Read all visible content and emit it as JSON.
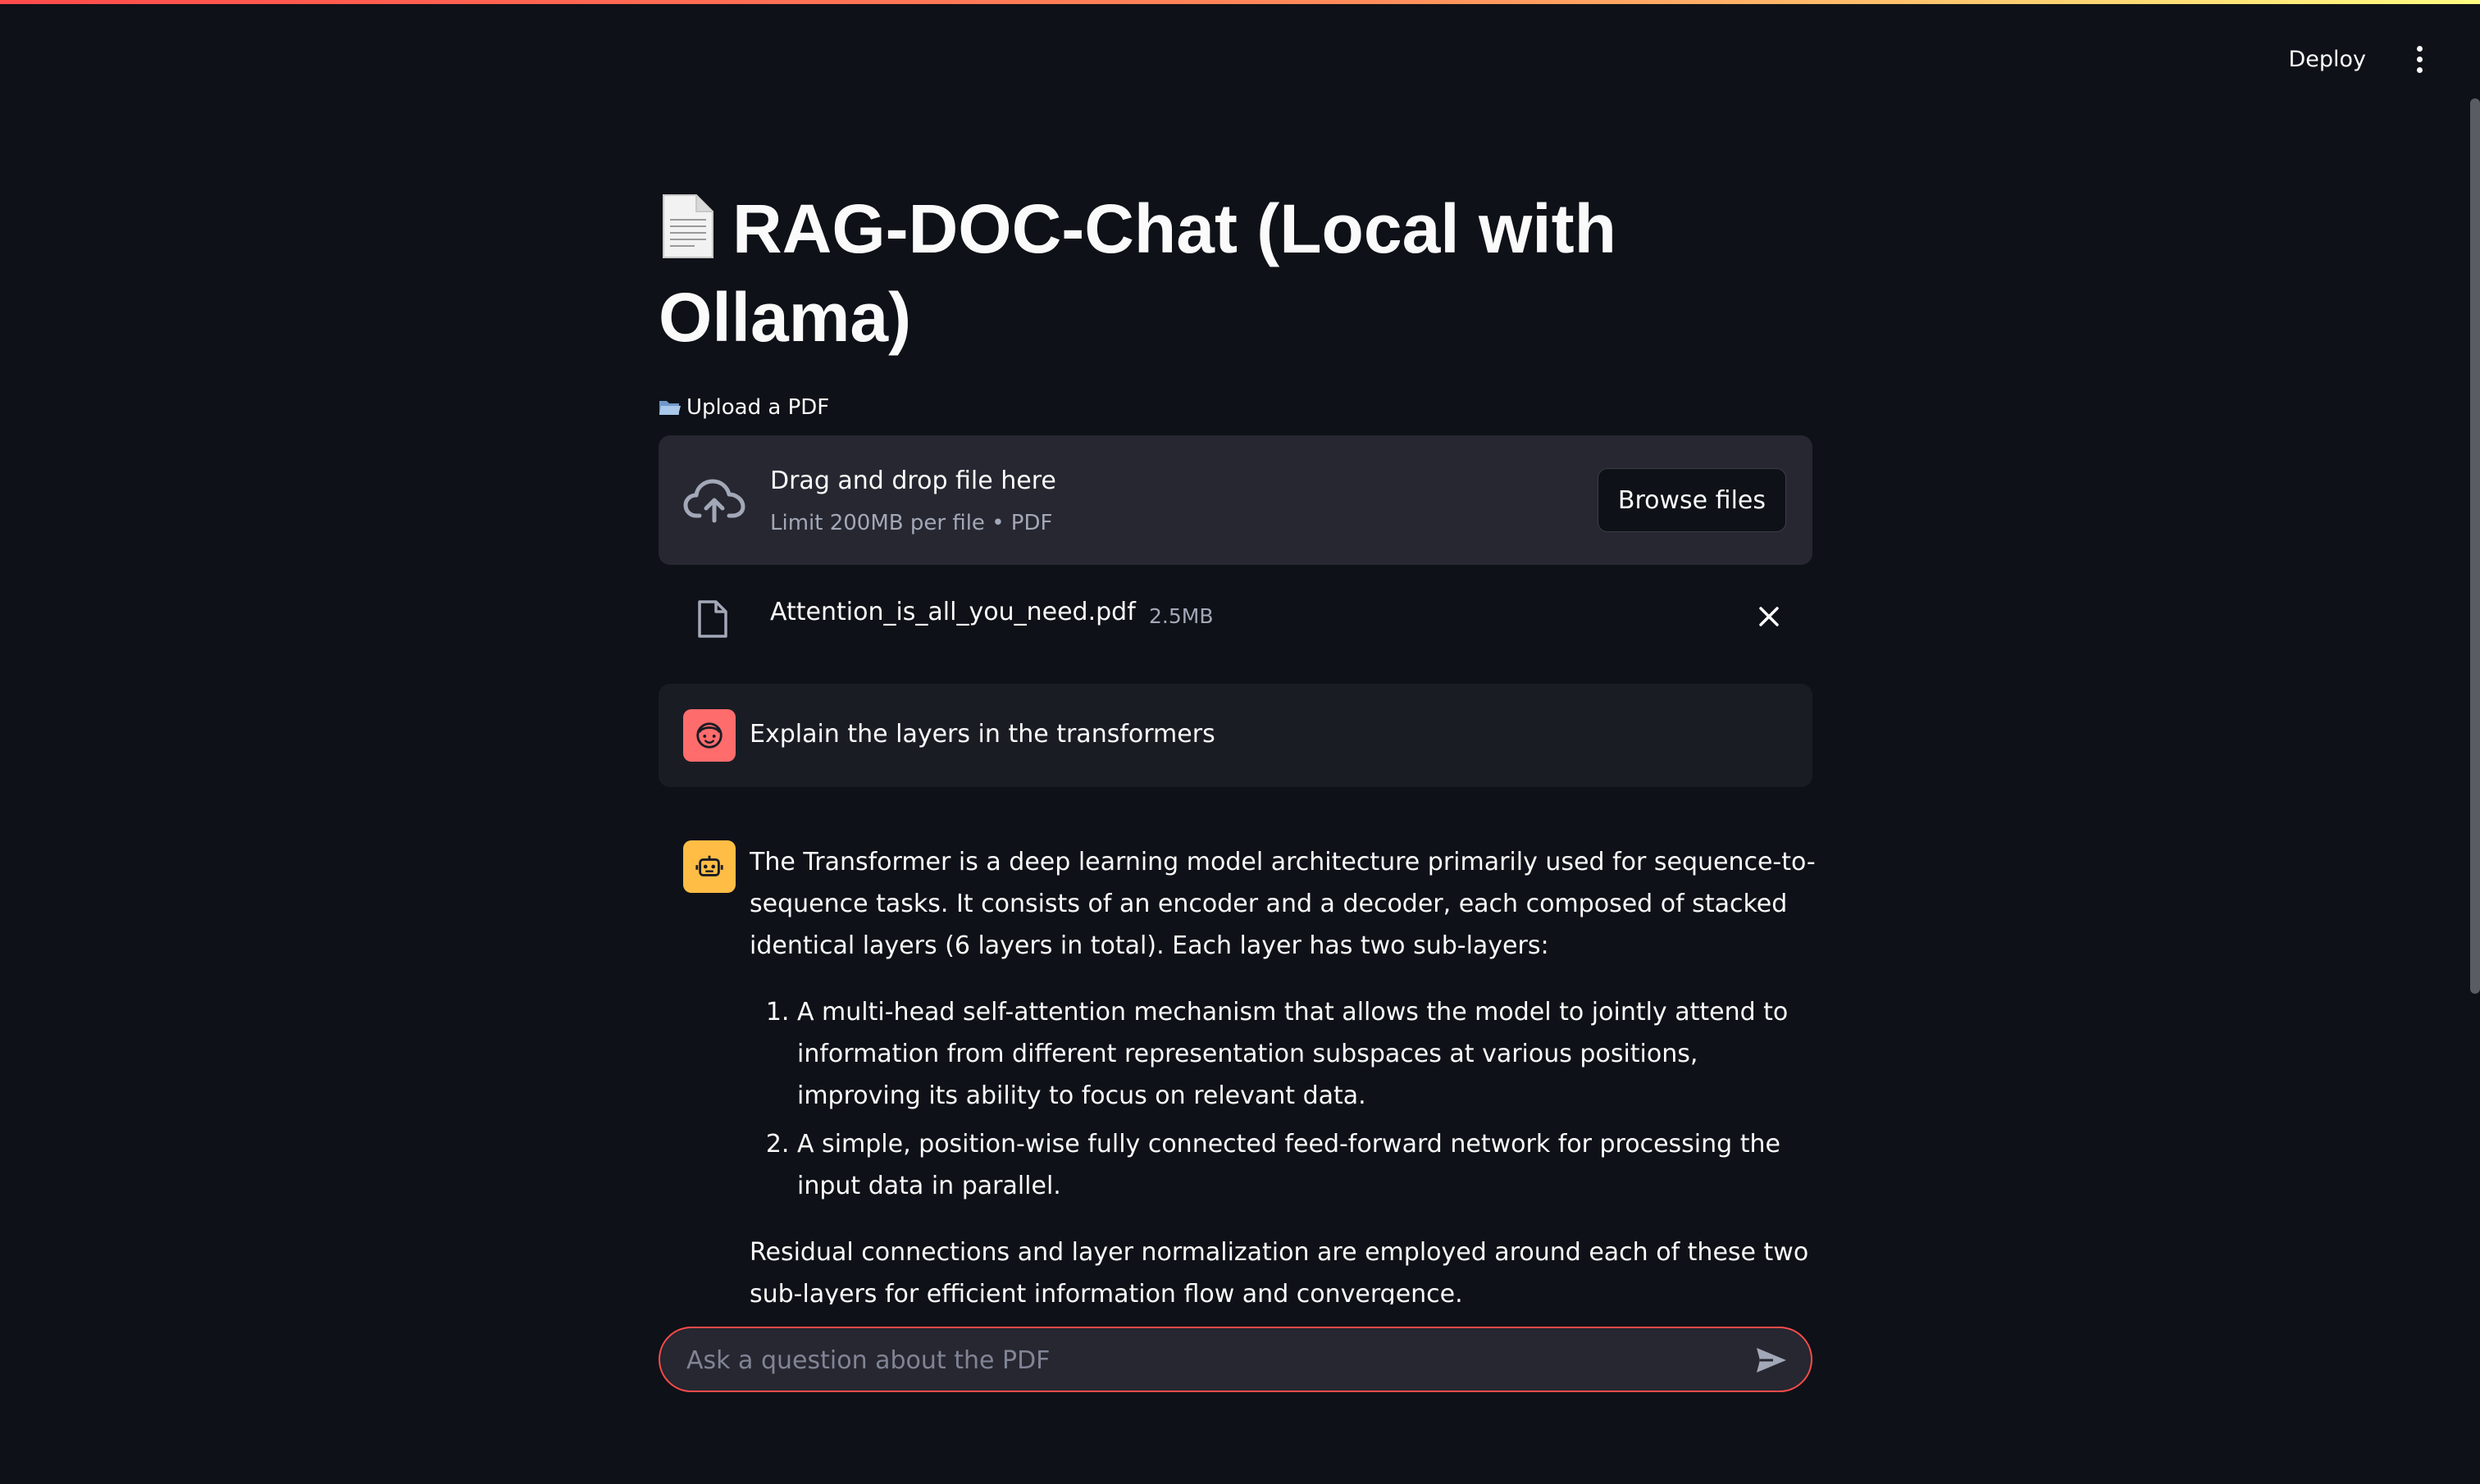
{
  "header": {
    "deploy_label": "Deploy"
  },
  "page": {
    "title_line1": "RAG-DOC-Chat (Local with",
    "title_line2": "Ollama)"
  },
  "uploader": {
    "label": "Upload a PDF",
    "instructions": "Drag and drop file here",
    "limit": "Limit 200MB per file • PDF",
    "browse_label": "Browse files"
  },
  "uploaded_file": {
    "name": "Attention_is_all_you_need.pdf",
    "size": "2.5MB"
  },
  "chat": {
    "user_message": "Explain the layers in the transformers",
    "assistant": {
      "intro": "The Transformer is a deep learning model architecture primarily used for sequence-to-sequence tasks. It consists of an encoder and a decoder, each composed of stacked identical layers (6 layers in total). Each layer has two sub-layers:",
      "items": [
        "A multi-head self-attention mechanism that allows the model to jointly attend to information from different representation subspaces at various positions, improving its ability to focus on relevant data.",
        "A simple, position-wise fully connected feed-forward network for processing the input data in parallel."
      ],
      "outro": "Residual connections and layer normalization are employed around each of these two sub-layers for efficient information flow and convergence."
    },
    "input_placeholder": "Ask a question about the PDF"
  },
  "colors": {
    "background": "#0e1117",
    "accent": "#ff4b4b",
    "user_avatar": "#ff6c6c",
    "assistant_avatar": "#ffbd45"
  },
  "icons": {
    "title": "page-facing-up-icon",
    "uploader_label": "open-folder-icon",
    "dropzone": "cloud-upload-icon",
    "file": "file-icon",
    "remove": "close-icon",
    "user_avatar": "face-icon",
    "assistant_avatar": "robot-icon",
    "send": "send-icon",
    "menu": "more-vertical-icon"
  }
}
